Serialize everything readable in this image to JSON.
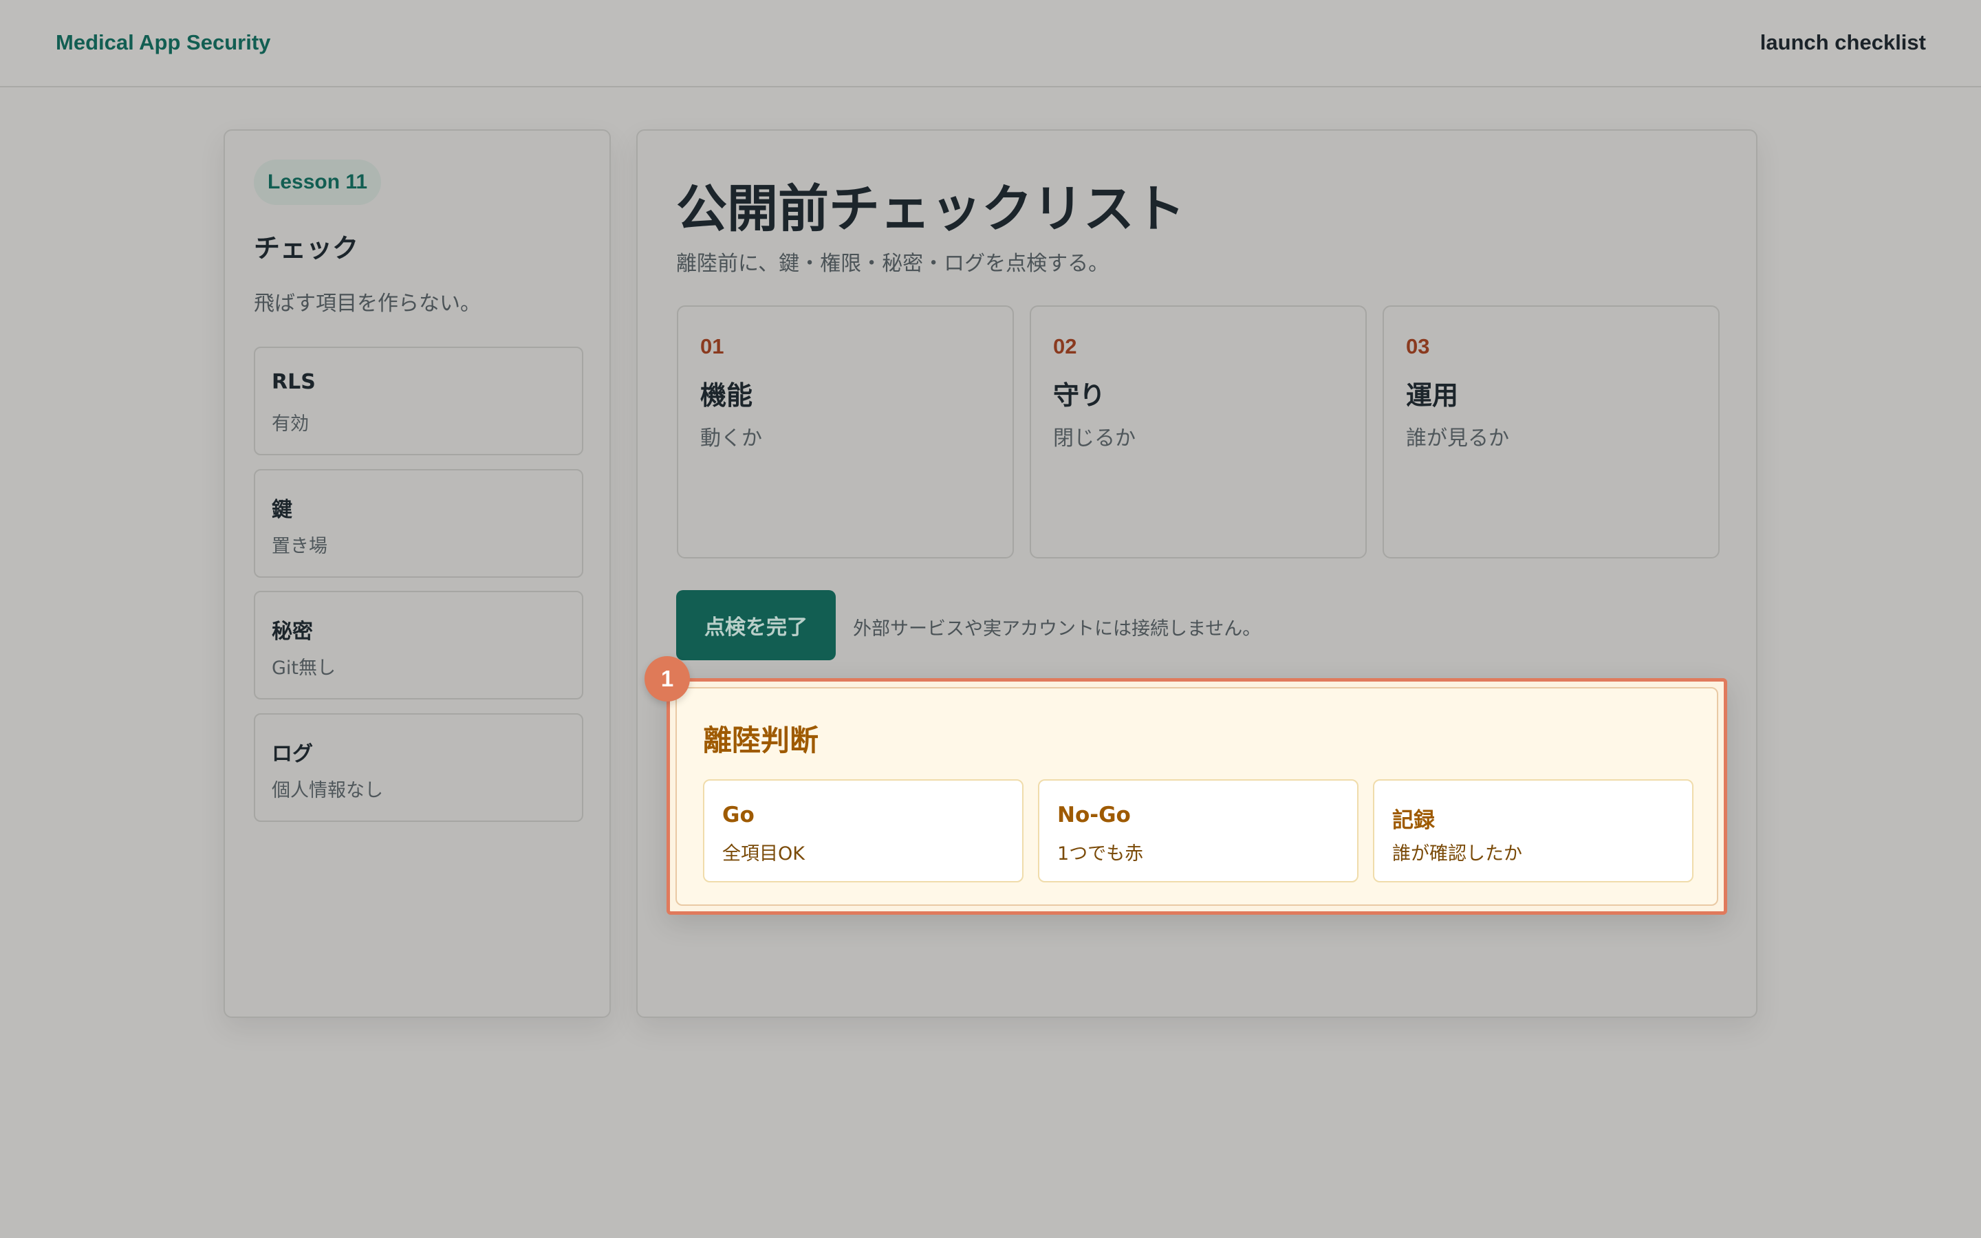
{
  "header": {
    "brand": "Medical App Security",
    "right_label": "launch checklist"
  },
  "sidebar": {
    "lesson": "Lesson 11",
    "title": "チェック",
    "subtitle": "飛ばす項目を作らない。",
    "items": [
      {
        "title": "RLS",
        "desc": "有効"
      },
      {
        "title": "鍵",
        "desc": "置き場"
      },
      {
        "title": "秘密",
        "desc": "Git無し"
      },
      {
        "title": "ログ",
        "desc": "個人情報なし"
      }
    ]
  },
  "main": {
    "title": "公開前チェックリスト",
    "subtitle": "離陸前に、鍵・権限・秘密・ログを点検する。",
    "steps": [
      {
        "num": "01",
        "title": "機能",
        "desc": "動くか"
      },
      {
        "num": "02",
        "title": "守り",
        "desc": "閉じるか"
      },
      {
        "num": "03",
        "title": "運用",
        "desc": "誰が見るか"
      }
    ],
    "complete_button": "点検を完了",
    "button_note": "外部サービスや実アカウントには接続しません。"
  },
  "callout": {
    "badge": "1",
    "title": "離陸判断",
    "items": [
      {
        "title": "Go",
        "desc": "全項目OK"
      },
      {
        "title": "No-Go",
        "desc": "1つでも赤"
      },
      {
        "title": "記録",
        "desc": "誰が確認したか"
      }
    ]
  },
  "colors": {
    "brand": "#125e52",
    "accent_orange": "#e07a5c",
    "callout_text": "#9e5a00",
    "step_number": "#8a3a1f"
  }
}
